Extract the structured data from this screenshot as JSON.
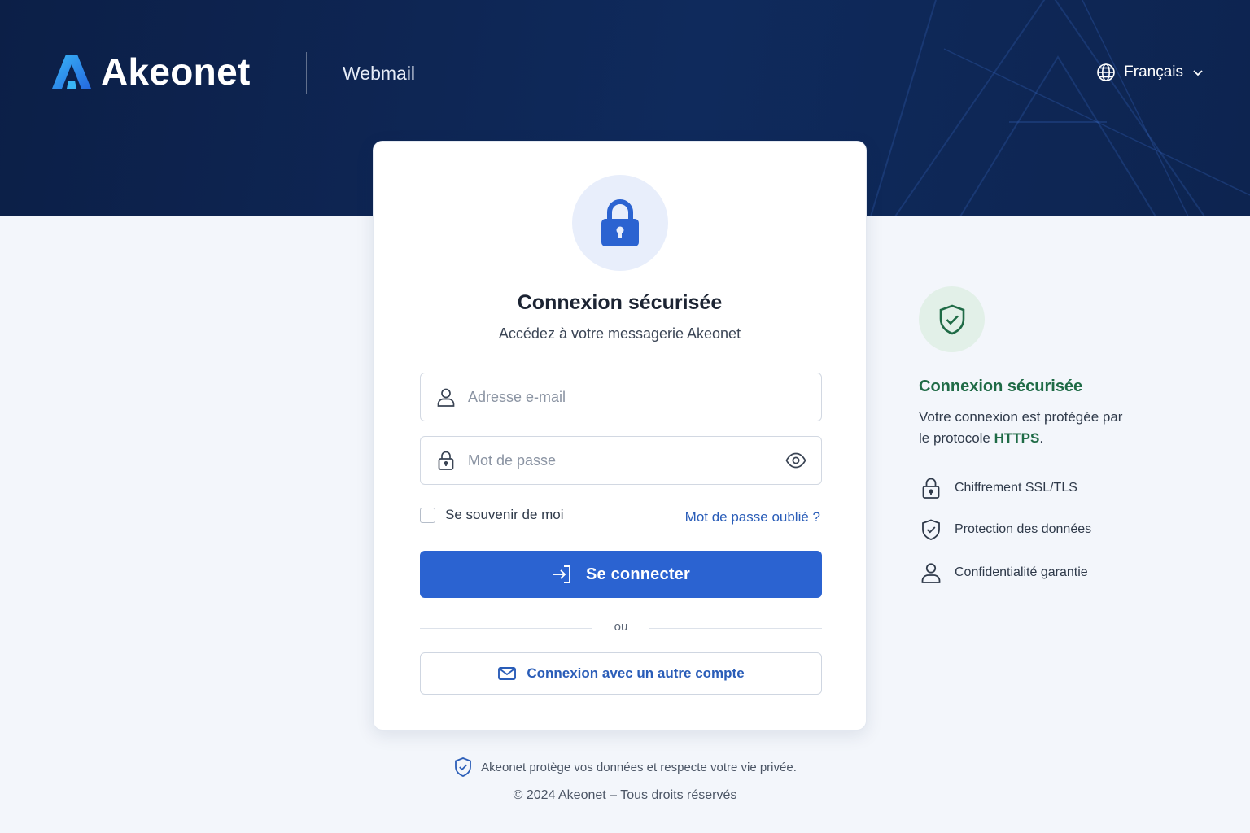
{
  "header": {
    "brand": "Akeonet",
    "product": "Webmail",
    "language": {
      "selected": "Français"
    }
  },
  "login_card": {
    "title": "Connexion sécurisée",
    "subtitle": "Accédez à votre messagerie Akeonet",
    "email_field": {
      "value": "",
      "placeholder": "Adresse e-mail"
    },
    "password_field": {
      "value": "",
      "placeholder": "Mot de passe"
    },
    "remember_me": {
      "label": "Se souvenir de moi",
      "checked": false
    },
    "forgot_password": "Mot de passe oublié ?",
    "login_button": "Se connecter",
    "separator": "ou",
    "alt_login_button": "Connexion avec un autre compte"
  },
  "security_panel": {
    "title": "Connexion sécurisée",
    "description": "Votre connexion est protégée par le protocole",
    "protocol": "HTTPS",
    "protocol_suffix": ".",
    "features": [
      {
        "icon": "lock-icon",
        "label": "Chiffrement SSL/TLS"
      },
      {
        "icon": "shield-check-icon",
        "label": "Protection des données"
      },
      {
        "icon": "user-icon",
        "label": "Confidentialité garantie"
      }
    ]
  },
  "footer": {
    "privacy": "Akeonet protège vos données et respecte votre vie privée.",
    "copyright": "© 2024 Akeonet – Tous droits réservés"
  },
  "colors": {
    "header_background": "#0f2a5c",
    "primary": "#2b63d1",
    "link": "#2a5db8",
    "security_green": "#1f6b46",
    "page_background": "#f3f6fb"
  }
}
